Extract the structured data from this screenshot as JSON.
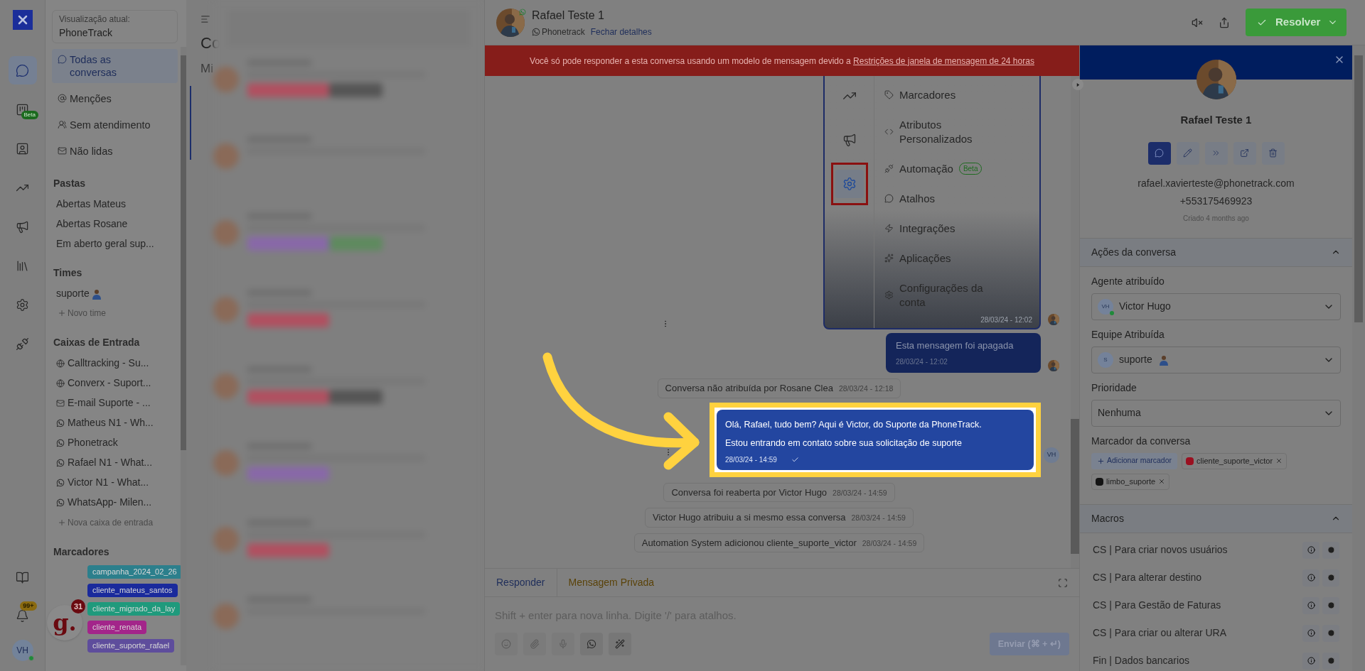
{
  "rail": {
    "items": [
      {
        "kind": "chat",
        "selected": true
      },
      {
        "kind": "kanban",
        "selected": false,
        "badge": "Beta"
      },
      {
        "kind": "contacts",
        "selected": false
      },
      {
        "kind": "reports",
        "selected": false
      },
      {
        "kind": "campaigns",
        "selected": false
      },
      {
        "kind": "library",
        "selected": false
      },
      {
        "kind": "settings",
        "selected": false
      },
      {
        "kind": "integrations",
        "selected": false
      }
    ],
    "bottom": [
      {
        "kind": "help"
      },
      {
        "kind": "notifications",
        "badge": "99+"
      }
    ],
    "avatar": {
      "initials": "VH",
      "online": true
    }
  },
  "widget": {
    "logo": "g.",
    "badge": "31"
  },
  "sidebar": {
    "view_label": "Visualização atual:",
    "view_name": "PhoneTrack",
    "nav": [
      {
        "kind": "chat",
        "label": "Todas as conversas",
        "selected": true
      },
      {
        "kind": "at",
        "label": "Menções",
        "selected": false
      },
      {
        "kind": "people",
        "label": "Sem atendimento",
        "selected": false
      },
      {
        "kind": "mail",
        "label": "Não lidas",
        "selected": false
      }
    ],
    "folders": {
      "title": "Pastas",
      "items": [
        "Abertas Mateus",
        "Abertas Rosane",
        "Em aberto geral sup..."
      ]
    },
    "teams": {
      "title": "Times",
      "items": [
        "suporte"
      ],
      "add": "Novo time"
    },
    "inboxes": {
      "title": "Caixas de Entrada",
      "items": [
        {
          "kind": "globe",
          "label": "Calltracking - Su..."
        },
        {
          "kind": "globe",
          "label": "Converx - Suport..."
        },
        {
          "kind": "mail",
          "label": "E-mail Suporte - ..."
        },
        {
          "kind": "whatsapp",
          "label": "Matheus N1 - Wh..."
        },
        {
          "kind": "whatsapp",
          "label": "Phonetrack"
        },
        {
          "kind": "whatsapp",
          "label": "Rafael N1 - What..."
        },
        {
          "kind": "whatsapp",
          "label": "Victor N1 - What..."
        },
        {
          "kind": "whatsapp",
          "label": "WhatsApp- Milen..."
        }
      ],
      "add": "Nova caixa de entrada"
    },
    "labels": {
      "title": "Marcadores",
      "items": [
        {
          "name": "campanha_2024_02_26",
          "color": "#2c7f8c"
        },
        {
          "name": "cliente_mateus_santos",
          "color": "#1a2a9c"
        },
        {
          "name": "cliente_migrado_da_lay",
          "color": "#1f9a7c"
        },
        {
          "name": "cliente_renata",
          "color": "#a3258a"
        },
        {
          "name": "cliente_suporte_rafael",
          "color": "#5e4d9c"
        }
      ]
    }
  },
  "list": {
    "title": "Co",
    "tab": "Mi"
  },
  "chat": {
    "contact": "Rafael Teste 1",
    "channel": "Phonetrack",
    "close_details": "Fechar detalhes",
    "banner": {
      "text": "Você só pode responder a esta conversa usando um modelo de mensagem devido a ",
      "link": "Restrições de janela de mensagem de 24 horas"
    },
    "settings_menu": {
      "nav": [
        {
          "kind": "reports",
          "selected": false
        },
        {
          "kind": "campaigns",
          "selected": false
        },
        {
          "kind": "settings",
          "selected": true
        }
      ],
      "items": [
        {
          "kind": "tag",
          "label": "Marcadores"
        },
        {
          "kind": "code",
          "label": "Atributos Personalizados"
        },
        {
          "kind": "automation",
          "label": "Automação",
          "badge": "Beta"
        },
        {
          "kind": "chat",
          "label": "Atalhos"
        },
        {
          "kind": "bolt",
          "label": "Integrações"
        },
        {
          "kind": "star",
          "label": "Aplicações"
        },
        {
          "kind": "gear",
          "label": "Configurações da conta"
        }
      ],
      "time": "28/03/24 - 12:02"
    },
    "messages": [
      {
        "kind": "outgoing",
        "text": "Esta mensagem foi apagada",
        "time": "28/03/24 - 12:02"
      },
      {
        "kind": "activity",
        "text": "Conversa não atribuída por Rosane Clea",
        "time": "28/03/24 - 12:18"
      },
      {
        "kind": "highlighted",
        "lines": [
          "Olá, Rafael, tudo bem? Aqui é Victor, do Suporte da PhoneTrack.",
          "Estou entrando em contato sobre sua solicitação de suporte"
        ],
        "time": "28/03/24 - 14:59",
        "avatar": "VH"
      },
      {
        "kind": "activity",
        "text": "Conversa foi reaberta por Victor Hugo",
        "time": "28/03/24 - 14:59"
      },
      {
        "kind": "activity",
        "text": "Victor Hugo atribuiu a si mesmo essa conversa",
        "time": "28/03/24 - 14:59"
      },
      {
        "kind": "activity",
        "text": "Automation System adicionou cliente_suporte_victor",
        "time": "28/03/24 - 14:59"
      }
    ],
    "composer": {
      "tabs": [
        {
          "label": "Responder",
          "selected": true
        },
        {
          "label": "Mensagem Privada",
          "selected": false
        }
      ],
      "placeholder": "Shift + enter para nova linha. Digite '/' para atalhos.",
      "send": "Enviar (⌘ + ↵)"
    },
    "resolve": "Resolver"
  },
  "contact": {
    "name": "Rafael Teste 1",
    "actions": [
      {
        "kind": "chat",
        "selected": true
      },
      {
        "kind": "edit",
        "selected": false
      },
      {
        "kind": "merge",
        "selected": false
      },
      {
        "kind": "open",
        "selected": false
      },
      {
        "kind": "delete",
        "selected": false
      }
    ],
    "email": "rafael.xavierteste@phonetrack.com",
    "phone": "+553175469923",
    "created": "Criado 4 months ago"
  },
  "conversation_actions": {
    "title": "Ações da conversa",
    "expanded": true,
    "agent": {
      "label": "Agente atribuído",
      "initials": "VH",
      "value": "Victor Hugo"
    },
    "team": {
      "label": "Equipe Atribuída",
      "initials": "S",
      "value": "suporte"
    },
    "priority": {
      "label": "Prioridade",
      "value": "Nenhuma"
    },
    "labels": {
      "label": "Marcador da conversa",
      "add": "Adicionar marcador",
      "items": [
        {
          "name": "cliente_suporte_victor",
          "color": "#9a1020"
        },
        {
          "name": "limbo_suporte",
          "color": "#141414"
        }
      ]
    }
  },
  "macros": {
    "title": "Macros",
    "expanded": true,
    "items": [
      "CS | Para criar novos usuários",
      "CS | Para alterar destino",
      "CS | Para Gestão de Faturas",
      "CS | Para criar ou alterar URA",
      "Fin | Dados bancarios"
    ]
  }
}
